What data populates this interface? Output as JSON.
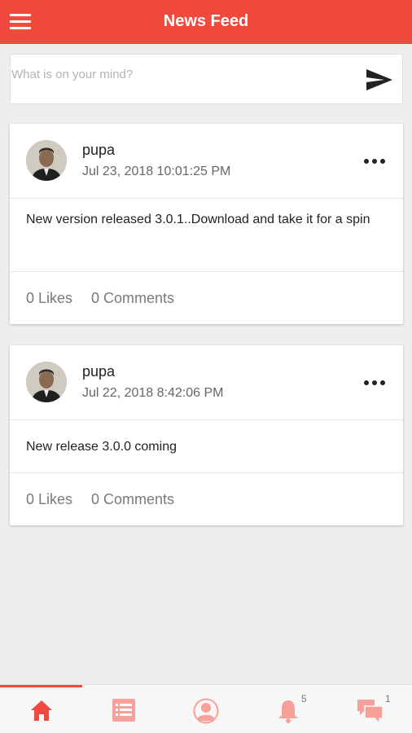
{
  "header": {
    "title": "News Feed"
  },
  "composer": {
    "placeholder": "What is on your mind?",
    "value": ""
  },
  "posts": [
    {
      "author": "pupa",
      "date": "Jul 23, 2018 10:01:25 PM",
      "text": "New version released 3.0.1..Download and take it for a spin",
      "likes": "0 Likes",
      "comments": "0 Comments"
    },
    {
      "author": "pupa",
      "date": "Jul 22, 2018 8:42:06 PM",
      "text": "New release 3.0.0 coming",
      "likes": "0 Likes",
      "comments": "0 Comments"
    }
  ],
  "bottom_nav": {
    "items": [
      {
        "icon": "home-icon",
        "active": true
      },
      {
        "icon": "list-icon",
        "active": false
      },
      {
        "icon": "profile-icon",
        "active": false
      },
      {
        "icon": "bell-icon",
        "active": false,
        "badge": "5"
      },
      {
        "icon": "chat-icon",
        "active": false,
        "badge": "1"
      }
    ]
  },
  "colors": {
    "accent": "#f0493e",
    "icon_inactive": "#f6a09a",
    "background": "#eeeeee"
  }
}
